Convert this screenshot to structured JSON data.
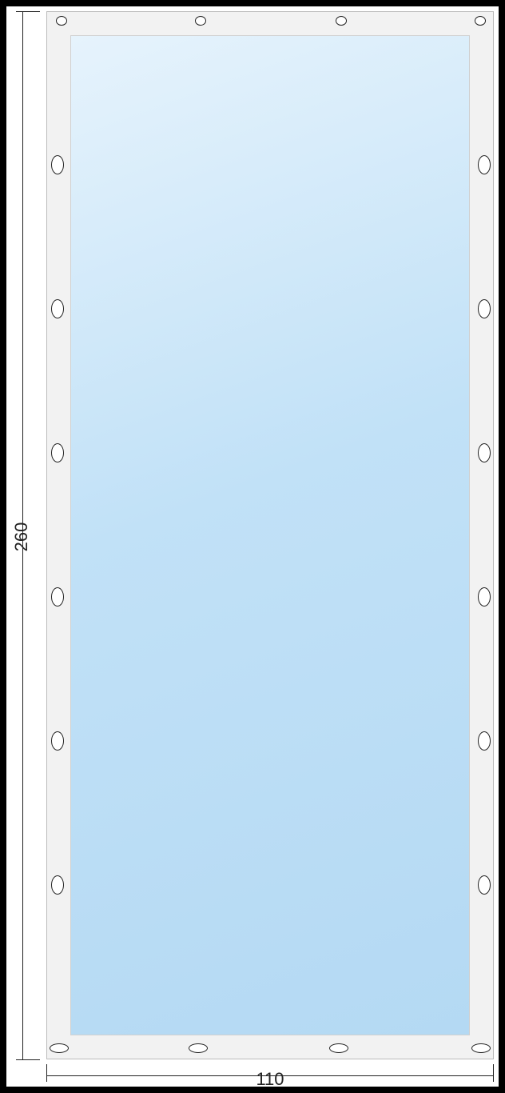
{
  "dimensions": {
    "height_label": "260",
    "width_label": "110"
  }
}
